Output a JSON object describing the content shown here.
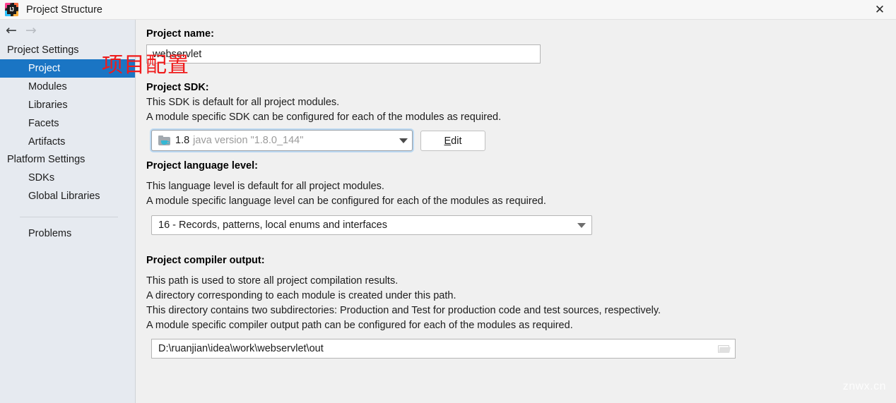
{
  "window": {
    "title": "Project Structure",
    "logo_icon": "intellij-idea-logo",
    "close_icon": "✕"
  },
  "nav": {
    "back_icon": "←",
    "forward_icon": "→"
  },
  "sidebar": {
    "groups": [
      {
        "title": "Project Settings",
        "items": [
          {
            "label": "Project",
            "selected": true
          },
          {
            "label": "Modules",
            "selected": false
          },
          {
            "label": "Libraries",
            "selected": false
          },
          {
            "label": "Facets",
            "selected": false
          },
          {
            "label": "Artifacts",
            "selected": false
          }
        ]
      },
      {
        "title": "Platform Settings",
        "items": [
          {
            "label": "SDKs",
            "selected": false
          },
          {
            "label": "Global Libraries",
            "selected": false
          }
        ]
      }
    ],
    "footer_items": [
      {
        "label": "Problems",
        "selected": false
      }
    ]
  },
  "main": {
    "project_name": {
      "label": "Project name:",
      "value": "webservlet"
    },
    "project_sdk": {
      "label": "Project SDK:",
      "desc_lines": [
        "This SDK is default for all project modules.",
        "A module specific SDK can be configured for each of the modules as required."
      ],
      "icon": "java-sdk-folder-icon",
      "version": "1.8",
      "detail": "java version \"1.8.0_144\"",
      "edit_button_mnemonic": "E",
      "edit_button_rest": "dit"
    },
    "language_level": {
      "label": "Project language level:",
      "desc_lines": [
        "This language level is default for all project modules.",
        "A module specific language level can be configured for each of the modules as required."
      ],
      "value": "16 - Records, patterns, local enums and interfaces"
    },
    "compiler_output": {
      "label": "Project compiler output:",
      "desc_lines": [
        "This path is used to store all project compilation results.",
        "A directory corresponding to each module is created under this path.",
        "This directory contains two subdirectories: Production and Test for production code and test sources, respectively.",
        "A module specific compiler output path can be configured for each of the modules as required."
      ],
      "value": "D:\\ruanjian\\idea\\work\\webservlet\\out",
      "browse_icon": "folder-browse-icon"
    }
  },
  "overlays": {
    "annotation_cn": "项目配置",
    "watermark": "znwx.cn"
  },
  "colors": {
    "selection_blue": "#1a75c4",
    "sidebar_bg": "#e6eaf0",
    "panel_bg": "#f0f0f0",
    "annotation_red": "#ef1c1c"
  }
}
